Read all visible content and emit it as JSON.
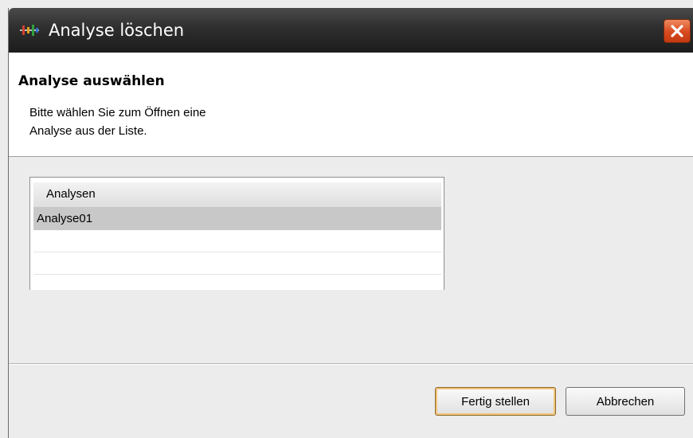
{
  "window": {
    "title": "Analyse löschen",
    "close_icon": "close-icon"
  },
  "header": {
    "title": "Analyse auswählen",
    "description_line1": "Bitte wählen Sie zum Öffnen eine",
    "description_line2": "Analyse aus der Liste."
  },
  "list": {
    "column_header": "Analysen",
    "rows": [
      "Analyse01",
      "",
      "",
      ""
    ],
    "selected_index": 0
  },
  "buttons": {
    "finish_label": "Fertig stellen",
    "cancel_label": "Abbrechen"
  },
  "colors": {
    "title_bar": "#2e2e2e",
    "close_button": "#d8491e",
    "selection": "#c8c8c8",
    "dialog_bg": "#ececec"
  }
}
